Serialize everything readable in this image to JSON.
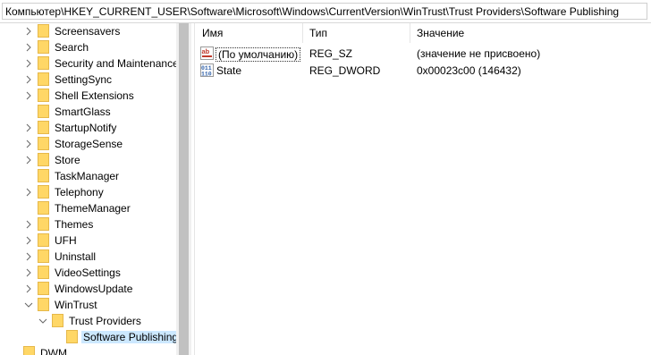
{
  "address": {
    "path": "Компьютер\\HKEY_CURRENT_USER\\Software\\Microsoft\\Windows\\CurrentVersion\\WinTrust\\Trust Providers\\Software Publishing"
  },
  "tree": {
    "items": [
      {
        "label": "Screensavers",
        "expander": "right"
      },
      {
        "label": "Search",
        "expander": "right"
      },
      {
        "label": "Security and Maintenance",
        "expander": "right"
      },
      {
        "label": "SettingSync",
        "expander": "right"
      },
      {
        "label": "Shell Extensions",
        "expander": "right"
      },
      {
        "label": "SmartGlass",
        "expander": "none"
      },
      {
        "label": "StartupNotify",
        "expander": "right"
      },
      {
        "label": "StorageSense",
        "expander": "right"
      },
      {
        "label": "Store",
        "expander": "right"
      },
      {
        "label": "TaskManager",
        "expander": "none"
      },
      {
        "label": "Telephony",
        "expander": "right"
      },
      {
        "label": "ThemeManager",
        "expander": "none"
      },
      {
        "label": "Themes",
        "expander": "right"
      },
      {
        "label": "UFH",
        "expander": "right"
      },
      {
        "label": "Uninstall",
        "expander": "right"
      },
      {
        "label": "VideoSettings",
        "expander": "right"
      },
      {
        "label": "WindowsUpdate",
        "expander": "right"
      },
      {
        "label": "WinTrust",
        "expander": "down"
      },
      {
        "label": "Trust Providers",
        "expander": "down"
      },
      {
        "label": "Software Publishing",
        "expander": "none",
        "selected": true
      },
      {
        "label": "DWM",
        "expander": "none"
      }
    ]
  },
  "list": {
    "columns": {
      "name": "Имя",
      "type": "Тип",
      "value": "Значение"
    },
    "rows": [
      {
        "icon": "string-value-icon",
        "name": "(По умолчанию)",
        "type": "REG_SZ",
        "value": "(значение не присвоено)"
      },
      {
        "icon": "dword-value-icon",
        "name": "State",
        "type": "REG_DWORD",
        "value": "0x00023c00 (146432)"
      }
    ]
  },
  "colors": {
    "folder": "#ffd766",
    "folder_dark": "#e6b84a",
    "selection": "#cce8ff",
    "string_icon": "#c0392b",
    "dword_icon": "#2e5fa8"
  }
}
